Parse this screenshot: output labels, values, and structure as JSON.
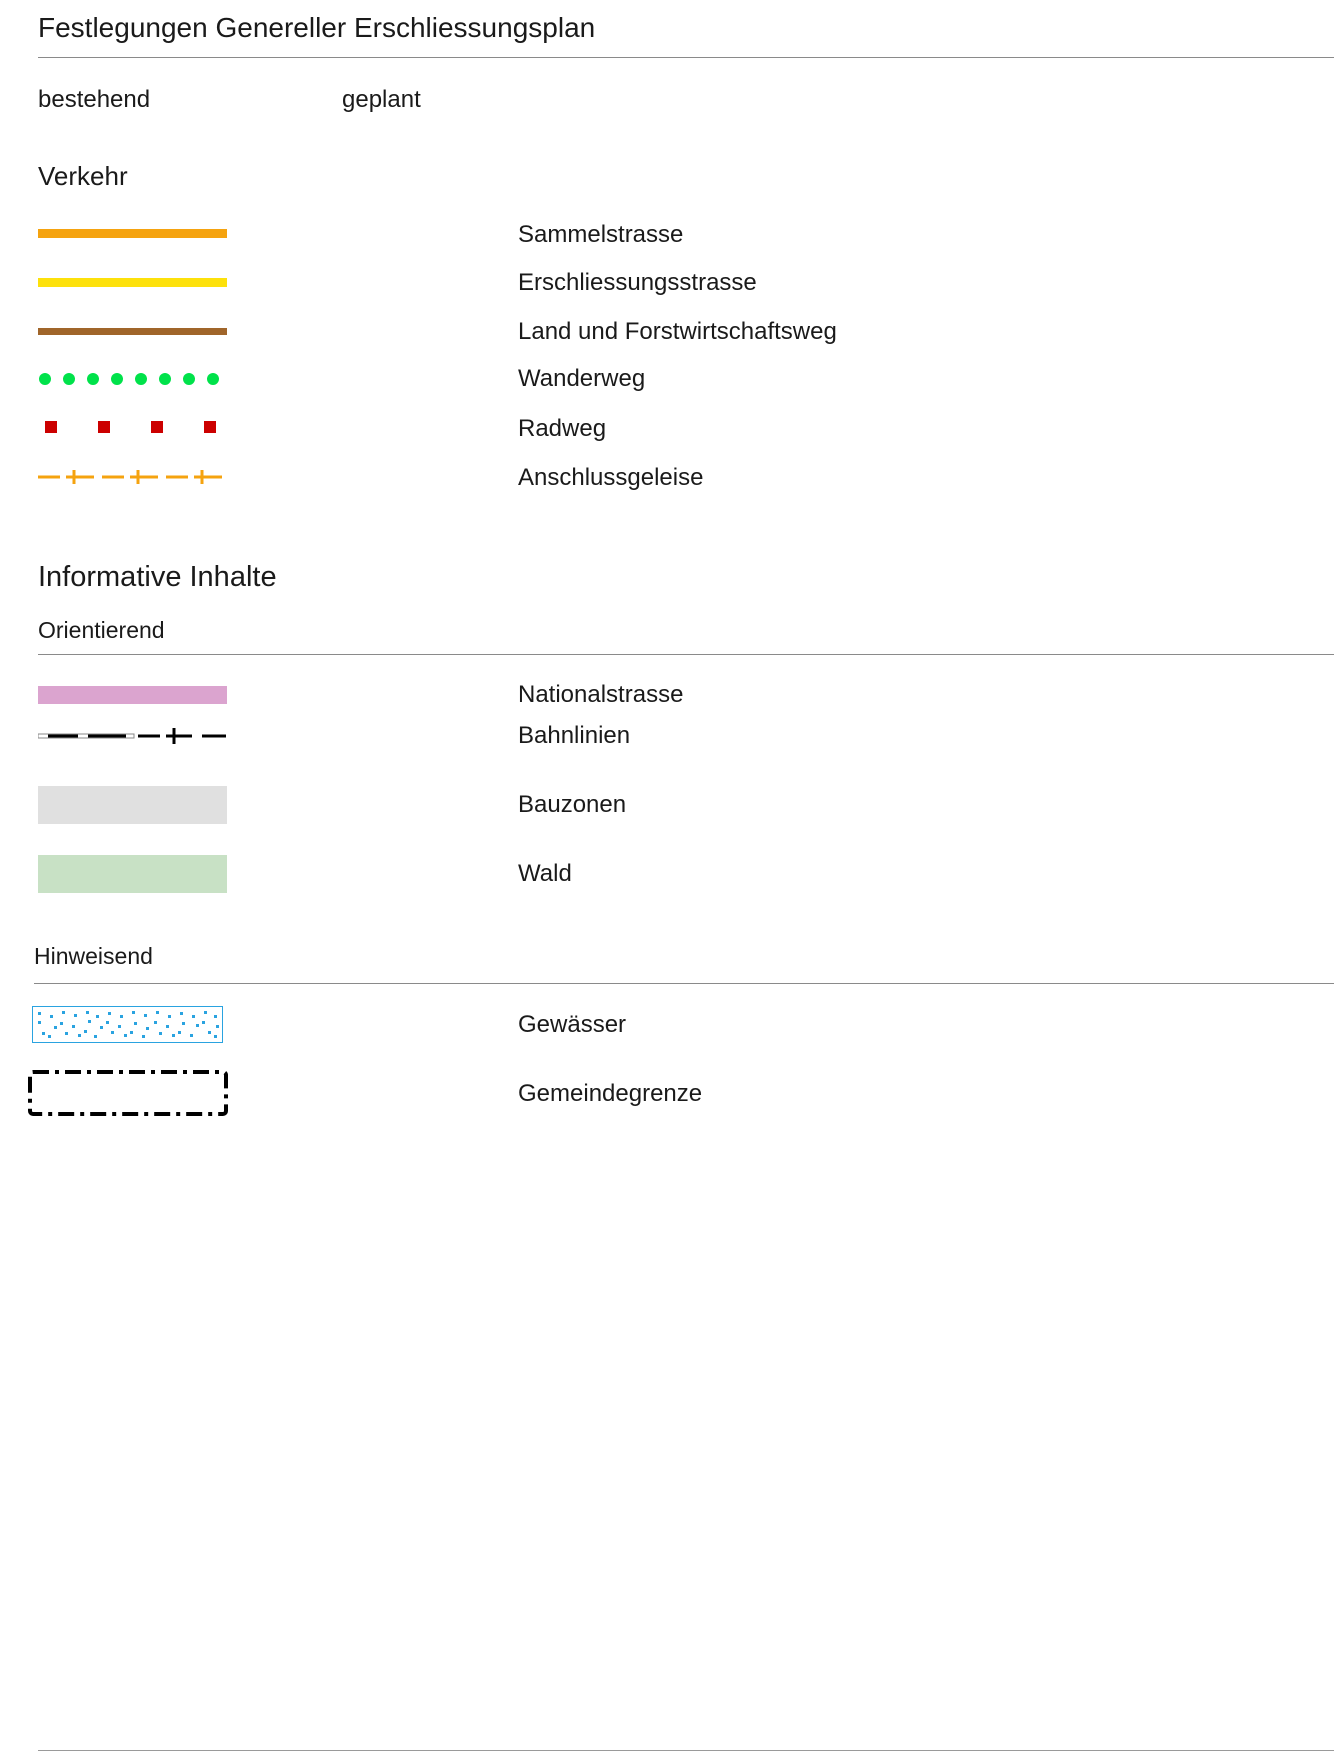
{
  "title": "Festlegungen Genereller Erschliessungsplan",
  "status_labels": {
    "existing": "bestehend",
    "planned": "geplant"
  },
  "verkehr": {
    "heading": "Verkehr",
    "items": [
      {
        "label": "Sammelstrasse",
        "color": "#f5a30f",
        "icon": "solid-line-symbol"
      },
      {
        "label": "Erschliessungsstrasse",
        "color": "#fde10b",
        "icon": "solid-line-symbol"
      },
      {
        "label": "Land und Forstwirtschaftsweg",
        "color": "#a0652a",
        "icon": "solid-line-symbol"
      },
      {
        "label": "Wanderweg",
        "color": "#00e24a",
        "icon": "dotted-line-symbol"
      },
      {
        "label": "Radweg",
        "color": "#cc0000",
        "icon": "square-dash-symbol"
      },
      {
        "label": "Anschlussgeleise",
        "color": "#f5a30f",
        "icon": "rail-dash-symbol"
      }
    ]
  },
  "informative": {
    "heading": "Informative Inhalte",
    "orientierend": {
      "heading": "Orientierend",
      "items": [
        {
          "label": "Nationalstrasse",
          "color": "#dba4cf",
          "icon": "band-symbol"
        },
        {
          "label": "Bahnlinien",
          "color": "#000000",
          "icon": "railway-symbol"
        },
        {
          "label": "Bauzonen",
          "color": "#e0e0e0",
          "icon": "area-symbol"
        },
        {
          "label": "Wald",
          "color": "#c8e1c5",
          "icon": "area-symbol"
        }
      ]
    },
    "hinweisend": {
      "heading": "Hinweisend",
      "items": [
        {
          "label": "Gewässer",
          "color": "#2aa3e0",
          "icon": "water-pattern-symbol"
        },
        {
          "label": "Gemeindegrenze",
          "color": "#000000",
          "icon": "dash-dot-border-symbol"
        }
      ]
    }
  }
}
